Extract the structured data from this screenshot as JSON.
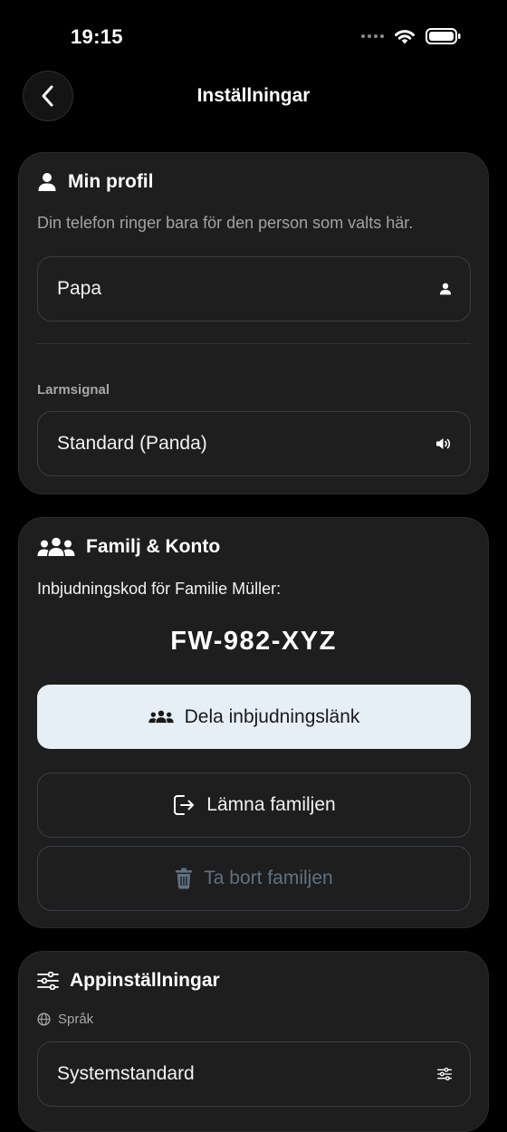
{
  "status_bar": {
    "time": "19:15"
  },
  "nav": {
    "title": "Inställningar"
  },
  "profile": {
    "title": "Min profil",
    "description": "Din telefon ringer bara för den person som valts här.",
    "person_value": "Papa",
    "alarm_label": "Larmsignal",
    "alarm_value": "Standard (Panda)"
  },
  "family": {
    "title": "Familj & Konto",
    "invite_label": "Inbjudningskod för Familie Müller:",
    "invite_code": "FW-982-XYZ",
    "share_label": "Dela inbjudningslänk",
    "leave_label": "Lämna familjen",
    "delete_label": "Ta bort familjen"
  },
  "app_settings": {
    "title": "Appinställningar",
    "language_label": "Språk",
    "language_value": "Systemstandard"
  },
  "colors": {
    "background": "#000000",
    "card": "#1e1e1e",
    "primary_button": "#e6eef6",
    "disabled_text": "#5e7282"
  },
  "icons": [
    "back-chevron-icon",
    "person-icon",
    "speaker-icon",
    "group-icon",
    "logout-icon",
    "trash-icon",
    "sliders-icon",
    "globe-icon",
    "wifi-icon",
    "battery-icon"
  ]
}
